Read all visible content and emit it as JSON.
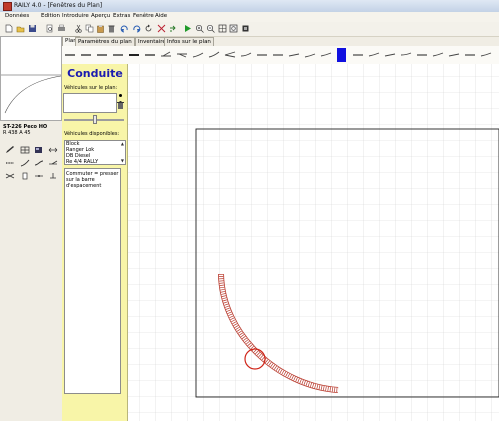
{
  "window": {
    "title": "RAILY 4.0 - [Fenêtres du Plan]"
  },
  "menu": [
    "Données",
    "Edition",
    "Introduire",
    "Aperçu",
    "Extras",
    "Fenêtre",
    "Aide"
  ],
  "toolbar_icons": [
    "new-file-icon",
    "open-folder-icon",
    "save-icon",
    "print-preview-icon",
    "print-icon",
    "cut-icon",
    "copy-icon",
    "paste-icon",
    "delete-icon",
    "undo-icon",
    "redo-icon",
    "rotate-icon",
    "scissors-icon",
    "mirror-icon",
    "play-icon",
    "zoom-in-icon",
    "zoom-out-icon",
    "zoom-fit-icon",
    "zoom-window-icon",
    "refresh-icon"
  ],
  "preview": {
    "track_name": "ST-226 Peco HO",
    "track_spec": "R 438 A 45"
  },
  "tabs": [
    {
      "label": "Plan",
      "active": true
    },
    {
      "label": "Paramètres du plan",
      "active": false
    },
    {
      "label": "Inventaire",
      "active": false
    },
    {
      "label": "Infos sur le plan",
      "active": false
    }
  ],
  "panel": {
    "title": "Conduite",
    "vehicles_on_plan_label": "Véhicules sur le plan:",
    "vehicles_available_label": "Véhicules disponibles:",
    "vehicles_available": [
      "Block",
      "Ranger Lok",
      "DB Diesel",
      "Re 4/4 RALLY"
    ],
    "help_text": "Commuter = presser sur la barre d'espacement"
  },
  "colors": {
    "panel_bg": "#f8f5a8",
    "heading": "#1b1bb0",
    "track": "#c0392b",
    "palette_selected": "#1010e0"
  }
}
